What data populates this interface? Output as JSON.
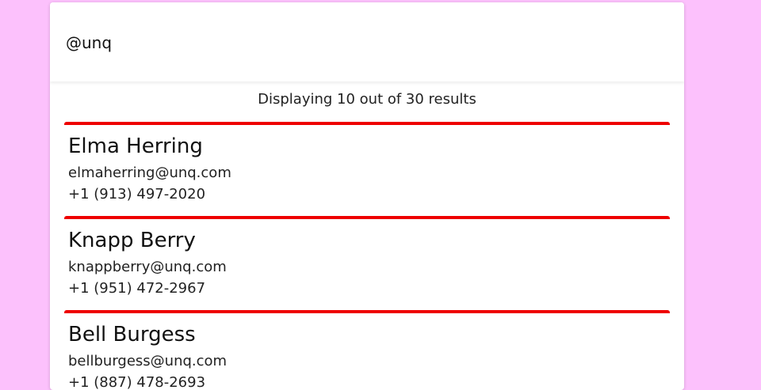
{
  "search": {
    "value": "@unq"
  },
  "summary": "Displaying 10 out of 30 results",
  "contacts": [
    {
      "name": "Elma Herring",
      "email": "elmaherring@unq.com",
      "phone": "+1 (913) 497-2020"
    },
    {
      "name": "Knapp Berry",
      "email": "knappberry@unq.com",
      "phone": "+1 (951) 472-2967"
    },
    {
      "name": "Bell Burgess",
      "email": "bellburgess@unq.com",
      "phone": "+1 (887) 478-2693"
    }
  ],
  "colors": {
    "background": "#fcc1fc",
    "card_accent": "#ee0000"
  }
}
